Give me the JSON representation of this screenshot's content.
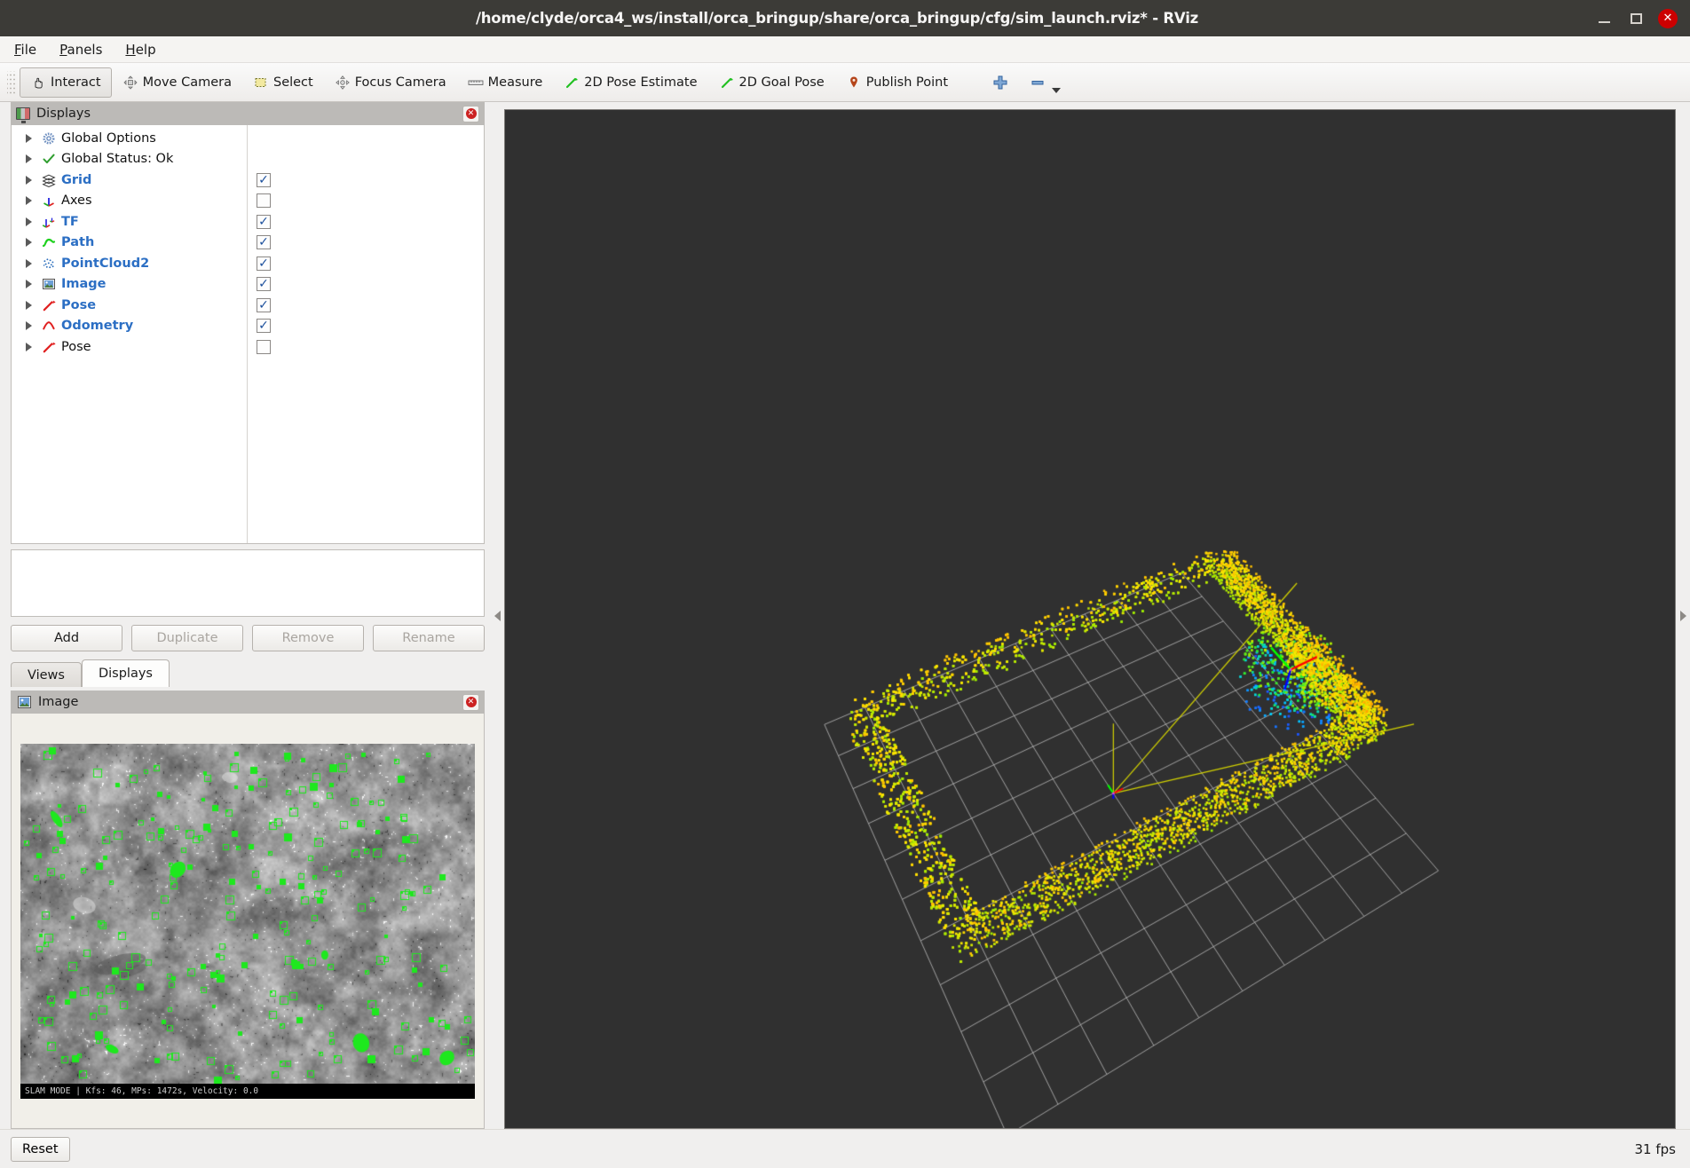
{
  "window": {
    "title": "/home/clyde/orca4_ws/install/orca_bringup/share/orca_bringup/cfg/sim_launch.rviz* - RViz",
    "minimize_label": "–",
    "maximize_label": "□",
    "close_label": "✕"
  },
  "menubar": {
    "items": [
      {
        "label": "File"
      },
      {
        "label": "Panels"
      },
      {
        "label": "Help"
      }
    ]
  },
  "toolbar": {
    "items": [
      {
        "label": "Interact",
        "icon": "hand-cursor-icon",
        "active": true
      },
      {
        "label": "Move Camera",
        "icon": "move-camera-icon",
        "active": false
      },
      {
        "label": "Select",
        "icon": "select-rectangle-icon",
        "active": false
      },
      {
        "label": "Focus Camera",
        "icon": "focus-camera-icon",
        "active": false
      },
      {
        "label": "Measure",
        "icon": "ruler-icon",
        "active": false
      },
      {
        "label": "2D Pose Estimate",
        "icon": "pose-arrow-icon",
        "active": false
      },
      {
        "label": "2D Goal Pose",
        "icon": "goal-arrow-icon",
        "active": false
      },
      {
        "label": "Publish Point",
        "icon": "map-pin-icon",
        "active": false
      }
    ],
    "plus_icon": "plus-icon",
    "minus_icon": "minus-icon",
    "overflow_icon": "chevron-down-icon"
  },
  "displays_panel": {
    "title": "Displays",
    "icon": "displays-monitor-icon",
    "close_icon": "close-icon",
    "columns": [
      "",
      ""
    ],
    "tree": [
      {
        "label": "Global Options",
        "icon": "gear-icon",
        "enabled": false,
        "checkbox": null,
        "expandable": true
      },
      {
        "label": "Global Status: Ok",
        "icon": "check-status-icon",
        "enabled": false,
        "checkbox": null,
        "expandable": true
      },
      {
        "label": "Grid",
        "icon": "grid-icon",
        "enabled": true,
        "checkbox": true,
        "expandable": true
      },
      {
        "label": "Axes",
        "icon": "axes-icon",
        "enabled": false,
        "checkbox": false,
        "expandable": true
      },
      {
        "label": "TF",
        "icon": "tf-frames-icon",
        "enabled": true,
        "checkbox": true,
        "expandable": true
      },
      {
        "label": "Path",
        "icon": "path-curve-icon",
        "enabled": true,
        "checkbox": true,
        "expandable": true
      },
      {
        "label": "PointCloud2",
        "icon": "pointcloud-icon",
        "enabled": true,
        "checkbox": true,
        "expandable": true
      },
      {
        "label": "Image",
        "icon": "image-icon",
        "enabled": true,
        "checkbox": true,
        "expandable": true
      },
      {
        "label": "Pose",
        "icon": "pose-arrow-icon",
        "enabled": true,
        "checkbox": true,
        "expandable": true
      },
      {
        "label": "Odometry",
        "icon": "odometry-icon",
        "enabled": true,
        "checkbox": true,
        "expandable": true
      },
      {
        "label": "Pose",
        "icon": "pose-arrow-icon",
        "enabled": false,
        "checkbox": false,
        "expandable": true
      }
    ],
    "buttons": [
      {
        "label": "Add",
        "disabled": false
      },
      {
        "label": "Duplicate",
        "disabled": true
      },
      {
        "label": "Remove",
        "disabled": true
      },
      {
        "label": "Rename",
        "disabled": true
      }
    ]
  },
  "tabs": [
    {
      "label": "Views",
      "selected": false
    },
    {
      "label": "Displays",
      "selected": true
    }
  ],
  "image_panel": {
    "title": "Image",
    "icon": "image-icon",
    "close_icon": "close-icon",
    "overlay_text": "SLAM MODE |  Kfs: 46, MPs: 1472s, Velocity: 0.0"
  },
  "viewport": {
    "background_color": "#303030",
    "grid_color": "#b4b4b4",
    "path_color": "#d2d200",
    "axis_x_color": "#ff0000",
    "axis_y_color": "#00ff00",
    "axis_z_color": "#0000ff",
    "pointcloud_colors": [
      "#88ee00",
      "#ffee00",
      "#00d0ff",
      "#2040ff",
      "#cc00cc"
    ],
    "collapse_left_icon": "chevron-left-icon",
    "collapse_right_icon": "chevron-right-icon"
  },
  "statusbar": {
    "reset_label": "Reset",
    "fps_label": "31 fps"
  }
}
